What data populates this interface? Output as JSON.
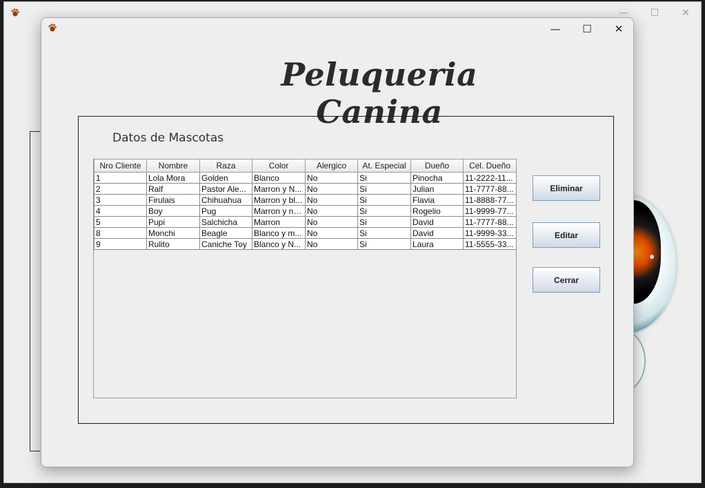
{
  "background_window": {
    "controls": {
      "minimize": "—",
      "maximize": "☐",
      "close": "✕"
    }
  },
  "dialog": {
    "controls": {
      "minimize": "—",
      "maximize": "☐",
      "close": "✕"
    },
    "heading": "Peluqueria Canina",
    "panel": {
      "label": "Datos de Mascotas",
      "table": {
        "columns": [
          "Nro Cliente",
          "Nombre",
          "Raza",
          "Color",
          "Alergico",
          "At. Especial",
          "Dueño",
          "Cel. Dueño"
        ],
        "rows": [
          [
            "1",
            "Lola Mora",
            "Golden",
            "Blanco",
            "No",
            "Si",
            "Pinocha",
            "11-2222-11..."
          ],
          [
            "2",
            "Ralf",
            "Pastor Ale...",
            "Marron y N...",
            "No",
            "Si",
            "Julian",
            "11-7777-88..."
          ],
          [
            "3",
            "Firulais",
            "Chihuahua",
            "Marron y bl...",
            "No",
            "Si",
            "Flavia",
            "11-8888-77..."
          ],
          [
            "4",
            "Boy",
            "Pug",
            "Marron y ne...",
            "No",
            "Si",
            "Rogelio",
            "11-9999-77..."
          ],
          [
            "5",
            "Pupi",
            "Salchicha",
            "Marron",
            "No",
            "Si",
            "David",
            "11-7777-88..."
          ],
          [
            "8",
            "Monchi",
            "Beagle",
            "Blanco y m...",
            "No",
            "Si",
            "David",
            "11-9999-33..."
          ],
          [
            "9",
            "Rulito",
            "Caniche Toy",
            "Blanco y N...",
            "No",
            "Si",
            "Laura",
            "11-5555-33..."
          ]
        ]
      },
      "buttons": {
        "delete": "Eliminar",
        "edit": "Editar",
        "close": "Cerrar"
      }
    }
  },
  "icons": {
    "app": "paw-icon"
  },
  "colors": {
    "window_bg": "#eeeeee",
    "button_border": "#7f99b3",
    "heading": "#2b2b2b"
  }
}
